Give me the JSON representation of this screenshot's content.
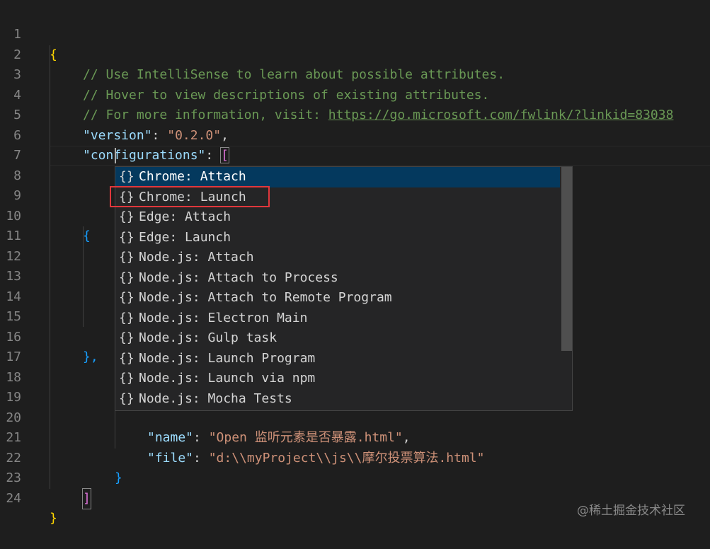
{
  "editor": {
    "line_numbers": [
      "1",
      "2",
      "3",
      "4",
      "5",
      "6",
      "7",
      "8",
      "9",
      "10",
      "11",
      "12",
      "13",
      "14",
      "15",
      "16",
      "17",
      "18",
      "19",
      "20",
      "21",
      "22",
      "23",
      "24"
    ],
    "lines": {
      "l1": "{",
      "l2_comment": "// Use IntelliSense to learn about possible attributes.",
      "l3_comment": "// Hover to view descriptions of existing attributes.",
      "l4_comment_prefix": "// For more information, visit: ",
      "l4_link": "https://go.microsoft.com/fwlink/?linkid=83038",
      "l5_key": "\"version\"",
      "l5_colon": ": ",
      "l5_val": "\"0.2.0\"",
      "l5_comma": ",",
      "l6_key": "\"configurations\"",
      "l6_colon": ": ",
      "l6_bracket": "[",
      "l10": "{",
      "l16": "},",
      "l20_key": "\"name\"",
      "l20_colon": ": ",
      "l20_val": "\"Open 监听元素是否暴露.html\"",
      "l20_comma": ",",
      "l21_key": "\"file\"",
      "l21_colon": ": ",
      "l21_val": "\"d:\\\\myProject\\\\js\\\\摩尔投票算法.html\"",
      "l22": "}",
      "l23": "]",
      "l24": "}"
    }
  },
  "suggest": {
    "icon": "{}",
    "icon_name": "braces-snippet-icon",
    "items": [
      "Chrome: Attach",
      "Chrome: Launch",
      "Edge: Attach",
      "Edge: Launch",
      "Node.js: Attach",
      "Node.js: Attach to Process",
      "Node.js: Attach to Remote Program",
      "Node.js: Electron Main",
      "Node.js: Gulp task",
      "Node.js: Launch Program",
      "Node.js: Launch via npm",
      "Node.js: Mocha Tests"
    ],
    "selected_index": 0,
    "highlighted_item": "Chrome: Launch"
  },
  "watermark": "@稀土掘金技术社区",
  "colors": {
    "background": "#1e1e1e",
    "comment": "#6a9955",
    "key": "#9cdcfe",
    "string": "#ce9178",
    "selected": "#04395e",
    "highlight_box": "#e0373c"
  }
}
